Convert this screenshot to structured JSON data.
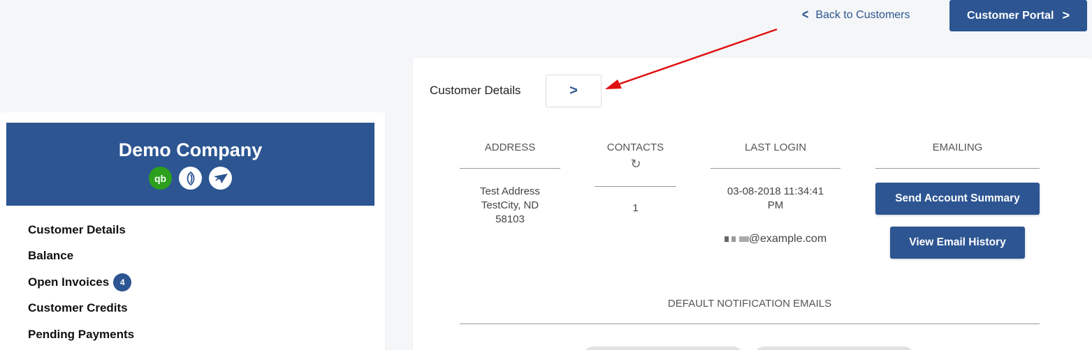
{
  "header": {
    "back_label": "Back to Customers",
    "portal_label": "Customer Portal"
  },
  "company": {
    "name": "Demo Company",
    "integrations": [
      {
        "name": "quickbooks-icon",
        "glyph": "qb",
        "color": "#2ca01c"
      },
      {
        "name": "leaf-icon",
        "glyph": "❦",
        "color": "#ffffff"
      },
      {
        "name": "bird-icon",
        "glyph": "➤",
        "color": "#ffffff"
      }
    ]
  },
  "nav": {
    "items": [
      {
        "label": "Customer Details"
      },
      {
        "label": "Balance"
      },
      {
        "label": "Open Invoices",
        "badge": "4"
      },
      {
        "label": "Customer Credits"
      },
      {
        "label": "Pending Payments"
      }
    ]
  },
  "details": {
    "title": "Customer Details",
    "columns": {
      "address": "ADDRESS",
      "contacts": "CONTACTS",
      "last_login": "LAST LOGIN",
      "emailing": "EMAILING"
    },
    "address_lines": [
      "Test Address",
      "TestCity, ND",
      "58103"
    ],
    "contacts_count": "1",
    "last_login_lines": [
      "03-08-2018 11:34:41",
      "PM"
    ],
    "email_suffix": "@example.com",
    "send_summary_label": "Send Account Summary",
    "email_history_label": "View Email History",
    "default_notifications_label": "DEFAULT NOTIFICATION EMAILS"
  },
  "colors": {
    "primary": "#2c5592",
    "annotation_arrow": "#e01010"
  }
}
